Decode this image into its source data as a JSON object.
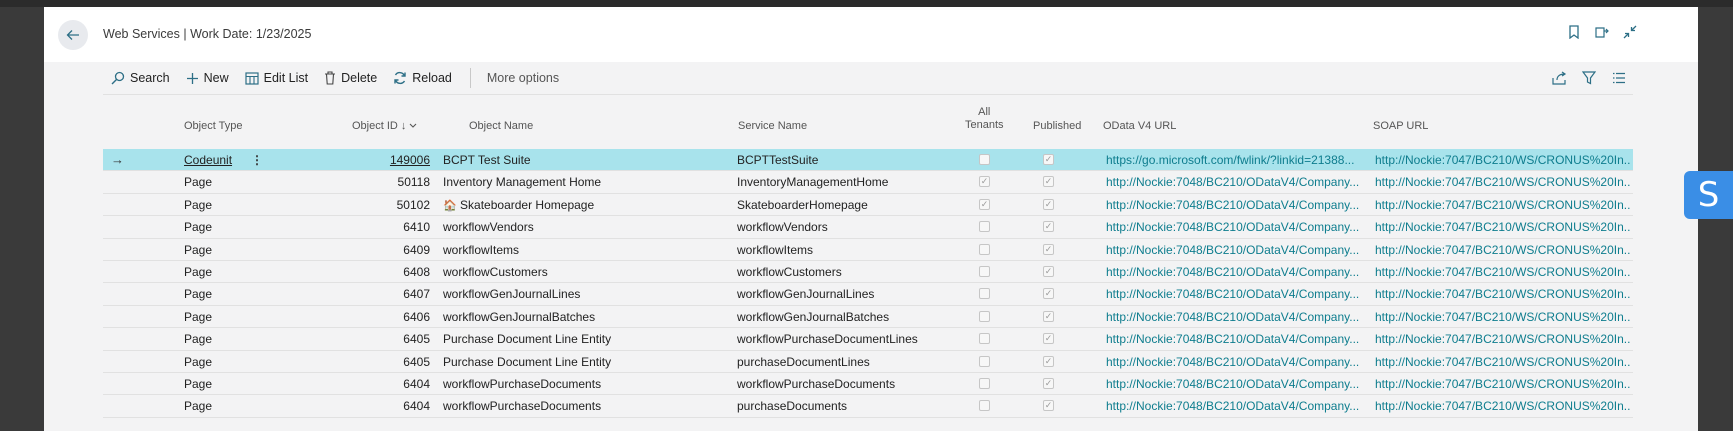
{
  "header": {
    "title": "Web Services | Work Date: 1/23/2025",
    "icons": [
      "back-arrow-icon",
      "bookmark-icon",
      "open-new-window-icon",
      "collapse-icon"
    ]
  },
  "actions": {
    "search": "Search",
    "new": "New",
    "edit_list": "Edit List",
    "delete": "Delete",
    "reload": "Reload",
    "more_options": "More options"
  },
  "columns": {
    "object_type": "Object Type",
    "object_id": "Object ID ↓",
    "object_name": "Object Name",
    "service_name": "Service Name",
    "all_tenants_1": "All",
    "all_tenants_2": "Tenants",
    "published": "Published",
    "odata_url": "OData V4 URL",
    "soap_url": "SOAP URL"
  },
  "rows": [
    {
      "type": "Codeunit",
      "id": "149006",
      "name": "BCPT Test Suite",
      "service": "BCPTTestSuite",
      "all_tenants": false,
      "published": true,
      "odata": "https://go.microsoft.com/fwlink/?linkid=21388...",
      "soap": "http://Nockie:7047/BC210/WS/CRONUS%20In..."
    },
    {
      "type": "Page",
      "id": "50118",
      "name": "Inventory Management Home",
      "service": "InventoryManagementHome",
      "all_tenants": true,
      "published": true,
      "odata": "http://Nockie:7048/BC210/ODataV4/Company...",
      "soap": "http://Nockie:7047/BC210/WS/CRONUS%20In..."
    },
    {
      "type": "Page",
      "id": "50102",
      "name": "Skateboarder Homepage",
      "name_icon": "🏠",
      "service": "SkateboarderHomepage",
      "all_tenants": true,
      "published": true,
      "odata": "http://Nockie:7048/BC210/ODataV4/Company...",
      "soap": "http://Nockie:7047/BC210/WS/CRONUS%20In..."
    },
    {
      "type": "Page",
      "id": "6410",
      "name": "workflowVendors",
      "service": "workflowVendors",
      "all_tenants": false,
      "published": true,
      "odata": "http://Nockie:7048/BC210/ODataV4/Company...",
      "soap": "http://Nockie:7047/BC210/WS/CRONUS%20In..."
    },
    {
      "type": "Page",
      "id": "6409",
      "name": "workflowItems",
      "service": "workflowItems",
      "all_tenants": false,
      "published": true,
      "odata": "http://Nockie:7048/BC210/ODataV4/Company...",
      "soap": "http://Nockie:7047/BC210/WS/CRONUS%20In..."
    },
    {
      "type": "Page",
      "id": "6408",
      "name": "workflowCustomers",
      "service": "workflowCustomers",
      "all_tenants": false,
      "published": true,
      "odata": "http://Nockie:7048/BC210/ODataV4/Company...",
      "soap": "http://Nockie:7047/BC210/WS/CRONUS%20In..."
    },
    {
      "type": "Page",
      "id": "6407",
      "name": "workflowGenJournalLines",
      "service": "workflowGenJournalLines",
      "all_tenants": false,
      "published": true,
      "odata": "http://Nockie:7048/BC210/ODataV4/Company...",
      "soap": "http://Nockie:7047/BC210/WS/CRONUS%20In..."
    },
    {
      "type": "Page",
      "id": "6406",
      "name": "workflowGenJournalBatches",
      "service": "workflowGenJournalBatches",
      "all_tenants": false,
      "published": true,
      "odata": "http://Nockie:7048/BC210/ODataV4/Company...",
      "soap": "http://Nockie:7047/BC210/WS/CRONUS%20In..."
    },
    {
      "type": "Page",
      "id": "6405",
      "name": "Purchase Document Line Entity",
      "service": "workflowPurchaseDocumentLines",
      "all_tenants": false,
      "published": true,
      "odata": "http://Nockie:7048/BC210/ODataV4/Company...",
      "soap": "http://Nockie:7047/BC210/WS/CRONUS%20In..."
    },
    {
      "type": "Page",
      "id": "6405",
      "name": "Purchase Document Line Entity",
      "service": "purchaseDocumentLines",
      "all_tenants": false,
      "published": true,
      "odata": "http://Nockie:7048/BC210/ODataV4/Company...",
      "soap": "http://Nockie:7047/BC210/WS/CRONUS%20In..."
    },
    {
      "type": "Page",
      "id": "6404",
      "name": "workflowPurchaseDocuments",
      "service": "workflowPurchaseDocuments",
      "all_tenants": false,
      "published": true,
      "odata": "http://Nockie:7048/BC210/ODataV4/Company...",
      "soap": "http://Nockie:7047/BC210/WS/CRONUS%20In..."
    },
    {
      "type": "Page",
      "id": "6404",
      "name": "workflowPurchaseDocuments",
      "service": "purchaseDocuments",
      "all_tenants": false,
      "published": true,
      "odata": "http://Nockie:7048/BC210/ODataV4/Company...",
      "soap": "http://Nockie:7047/BC210/WS/CRONUS%20In..."
    }
  ],
  "side_badge": "S",
  "colors": {
    "accent": "#0e7d8e",
    "selected_row": "#a8e3ec",
    "badge": "#3a8ee6"
  }
}
